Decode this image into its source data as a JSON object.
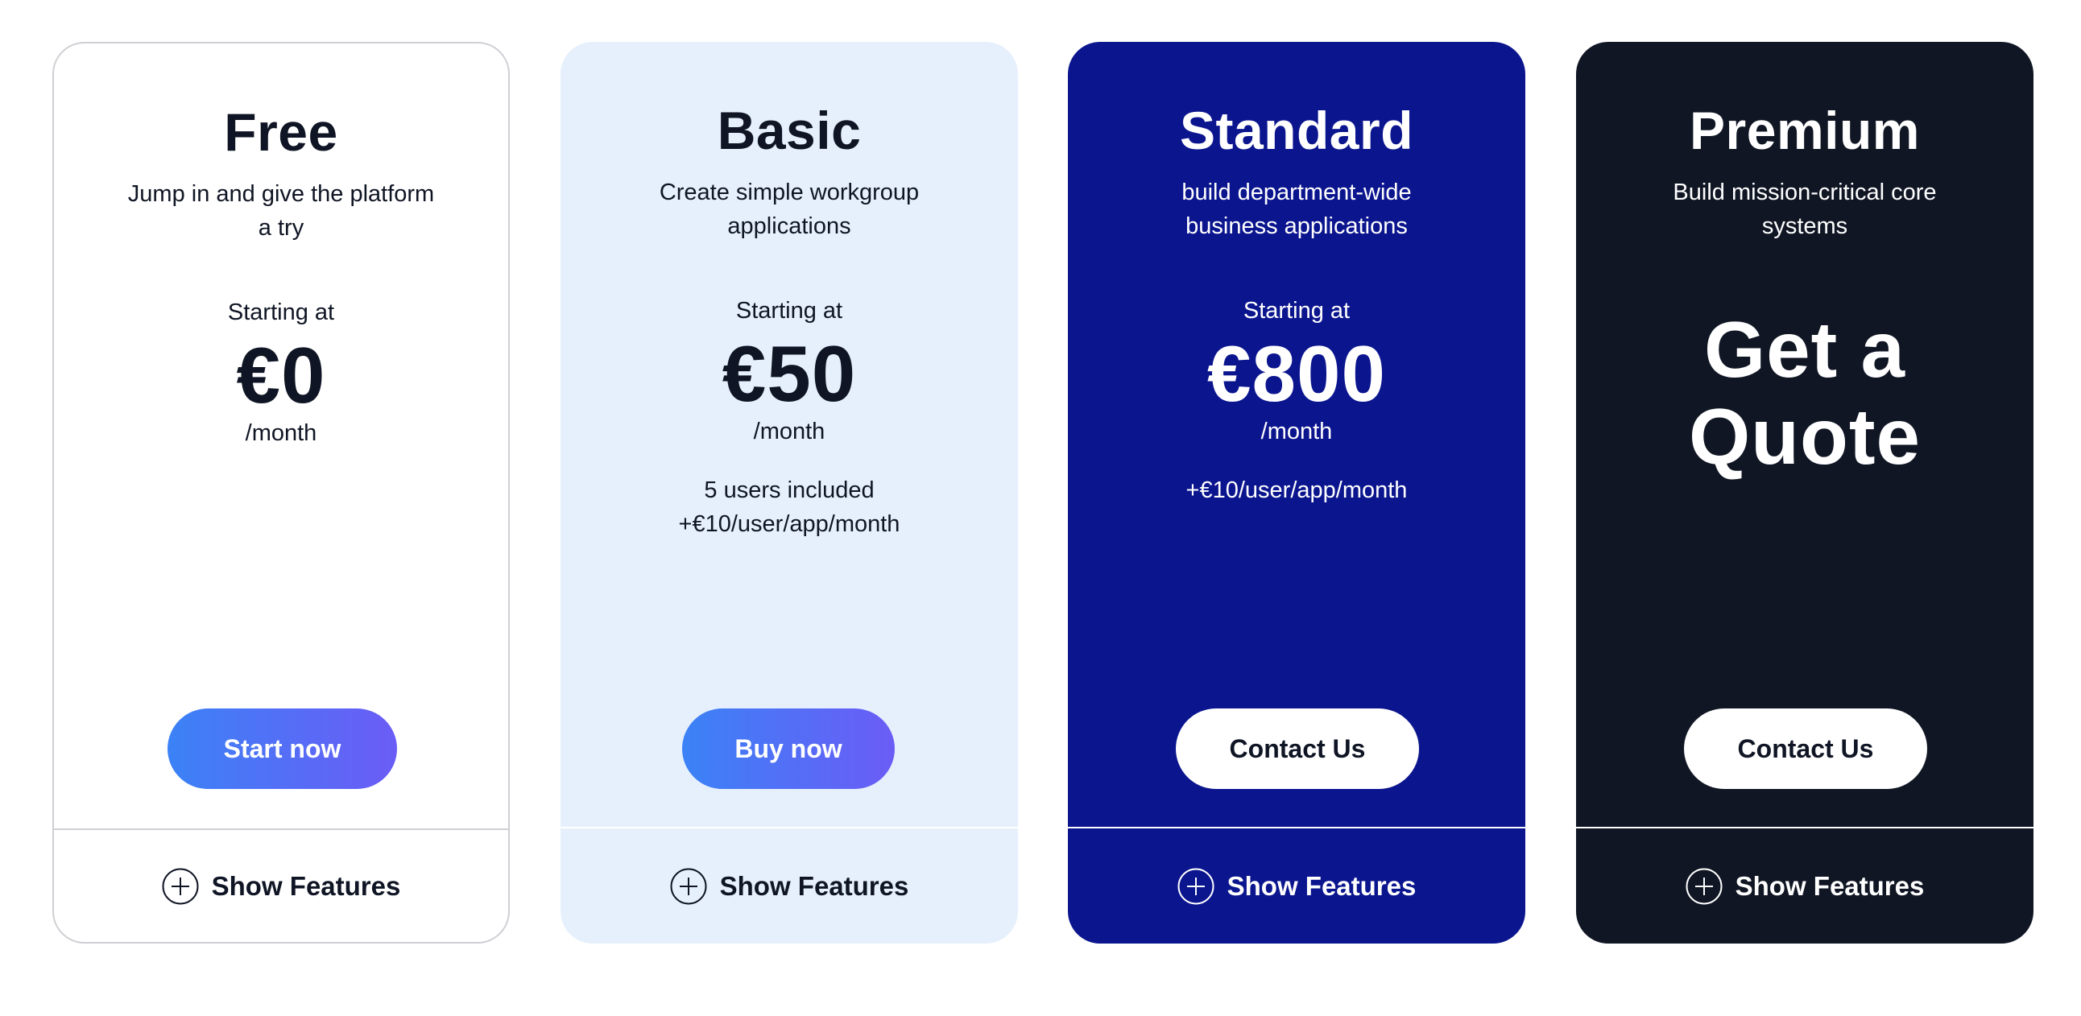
{
  "plans": [
    {
      "name": "Free",
      "tagline": "Jump in and give the platform a try",
      "starting": "Starting at",
      "price": "€0",
      "per": "/month",
      "notes": [],
      "cta": "Start now",
      "features": "Show Features"
    },
    {
      "name": "Basic",
      "tagline": "Create simple workgroup applications",
      "starting": "Starting at",
      "price": "€50",
      "per": "/month",
      "notes": [
        "5 users included",
        "+€10/user/app/month"
      ],
      "cta": "Buy now",
      "features": "Show Features"
    },
    {
      "name": "Standard",
      "tagline": "build department-wide business applications",
      "starting": "Starting at",
      "price": "€800",
      "per": "/month",
      "notes": [
        "+€10/user/app/month"
      ],
      "cta": "Contact Us",
      "features": "Show Features"
    },
    {
      "name": "Premium",
      "tagline": "Build mission-critical core systems",
      "quote": "Get a Quote",
      "cta": "Contact Us",
      "features": "Show Features"
    }
  ],
  "colors": {
    "free_bg": "#ffffff",
    "basic_bg": "#e6f0fc",
    "standard_bg": "#0b158e",
    "premium_bg": "#101624",
    "gradient_start": "#3b82f6",
    "gradient_end": "#6b5cf6",
    "dark_text": "#0f1524"
  },
  "icons": {
    "features_icon": "plus-circle-icon"
  }
}
